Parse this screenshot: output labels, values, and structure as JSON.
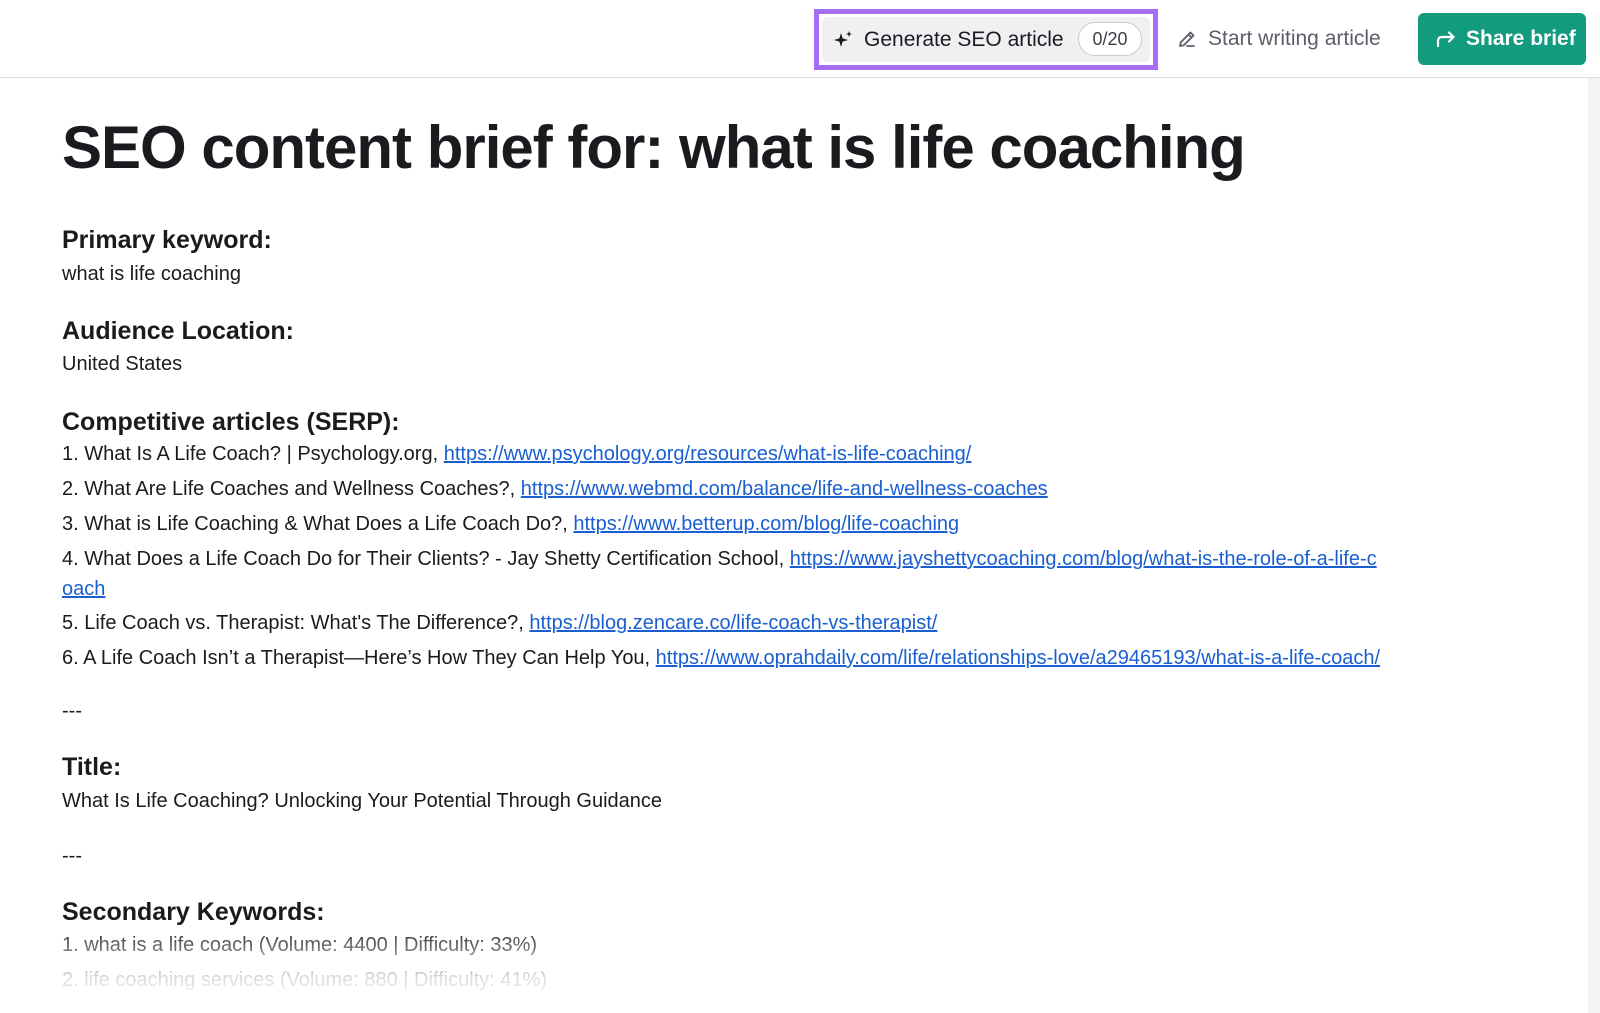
{
  "toolbar": {
    "generate_label": "Generate SEO article",
    "generate_count": "0/20",
    "write_label": "Start writing article",
    "share_label": "Share brief",
    "accent_highlight": "#a56cf5",
    "share_color": "#129b7f"
  },
  "brief": {
    "title": "SEO content brief for: what is life coaching",
    "primary_keyword_label": "Primary keyword:",
    "primary_keyword": "what is life coaching",
    "audience_label": "Audience Location:",
    "audience": "United States",
    "competitive_label": "Competitive articles (SERP):",
    "articles": [
      {
        "prefix": "1. What Is A Life Coach? | Psychology.org, ",
        "url": "https://www.psychology.org/resources/what-is-life-coaching/"
      },
      {
        "prefix": "2. What Are Life Coaches and Wellness Coaches?, ",
        "url": "https://www.webmd.com/balance/life-and-wellness-coaches"
      },
      {
        "prefix": "3. What is Life Coaching & What Does a Life Coach Do?, ",
        "url": "https://www.betterup.com/blog/life-coaching"
      },
      {
        "prefix": "4. What Does a Life Coach Do for Their Clients? - Jay Shetty Certification School, ",
        "url": "https://www.jayshettycoaching.com/blog/what-is-the-role-of-a-life-c",
        "url_cont": "oach"
      },
      {
        "prefix": "5. Life Coach vs. Therapist: What's The Difference?, ",
        "url": "https://blog.zencare.co/life-coach-vs-therapist/"
      },
      {
        "prefix": "6. A Life Coach Isn’t a Therapist—Here’s How They Can Help You, ",
        "url": "https://www.oprahdaily.com/life/relationships-love/a29465193/what-is-a-life-coach/"
      }
    ],
    "separator": "---",
    "title_label": "Title:",
    "title_value": "What Is Life Coaching? Unlocking Your Potential Through Guidance",
    "secondary_label": "Secondary Keywords:",
    "secondary": [
      "1. what is a life coach (Volume: 4400 | Difficulty: 33%)",
      "2. life coaching services (Volume: 880 | Difficulty: 41%)"
    ]
  }
}
